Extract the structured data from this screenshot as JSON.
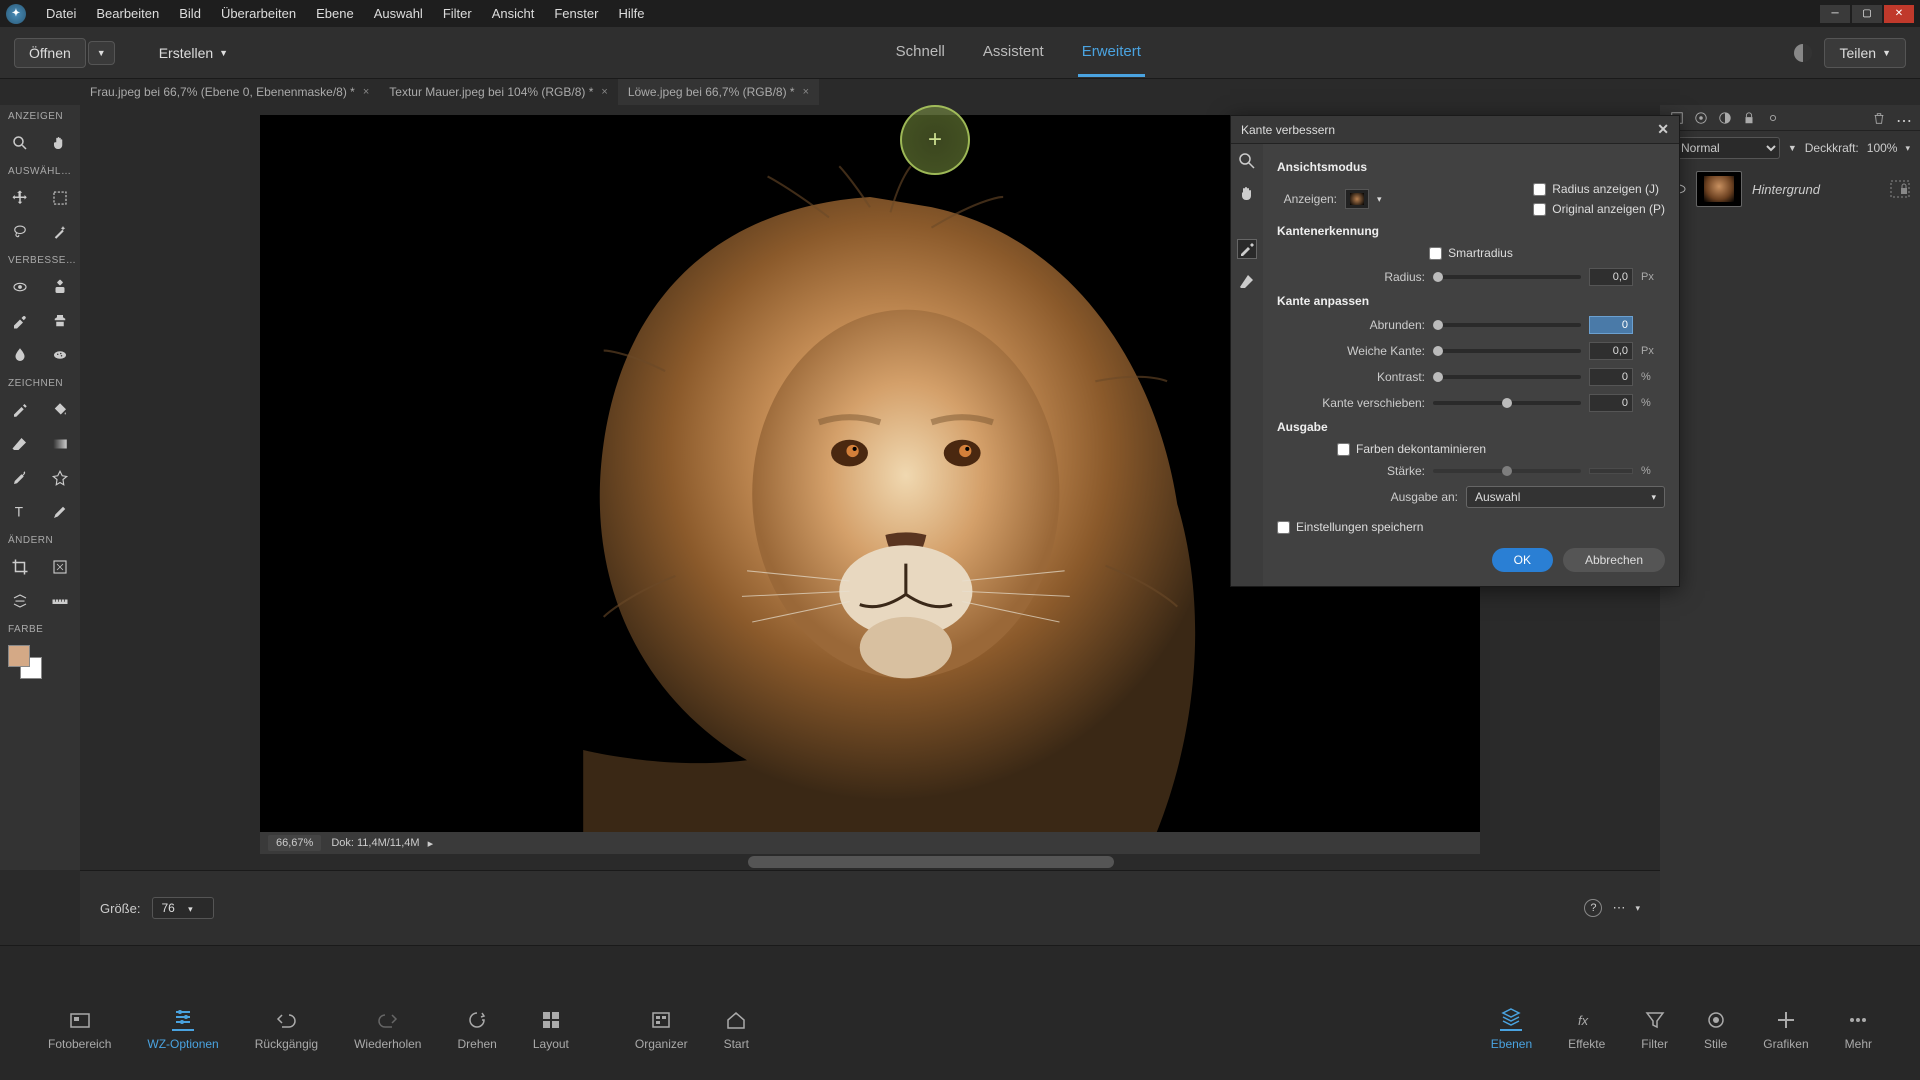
{
  "menubar": {
    "items": [
      "Datei",
      "Bearbeiten",
      "Bild",
      "Überarbeiten",
      "Ebene",
      "Auswahl",
      "Filter",
      "Ansicht",
      "Fenster",
      "Hilfe"
    ]
  },
  "toolbar": {
    "open_label": "Öffnen",
    "create_label": "Erstellen",
    "modes": [
      "Schnell",
      "Assistent",
      "Erweitert"
    ],
    "active_mode": 2,
    "share_label": "Teilen"
  },
  "doc_tabs": [
    {
      "label": "Frau.jpeg bei 66,7% (Ebene 0, Ebenenmaske/8) *"
    },
    {
      "label": "Textur Mauer.jpeg bei 104% (RGB/8) *"
    },
    {
      "label": "Löwe.jpeg bei 66,7% (RGB/8) *"
    }
  ],
  "active_doc": 2,
  "left_panel": {
    "sections": {
      "anzeigen": "ANZEIGEN",
      "auswaehlen": "AUSWÄHL…",
      "verbessern": "VERBESSE…",
      "zeichnen": "ZEICHNEN",
      "aendern": "ÄNDERN",
      "farbe": "FARBE"
    },
    "fg_color": "#d4a986",
    "bg_color": "#ffffff"
  },
  "canvas": {
    "zoom": "66,67%",
    "doc_info": "Dok: 11,4M/11,4M"
  },
  "right_panel": {
    "trash_icon": "trash",
    "blend_mode": "Normal",
    "opacity_label": "Deckkraft:",
    "opacity_value": "100%",
    "layer_name": "Hintergrund"
  },
  "dialog": {
    "title": "Kante verbessern",
    "section_view": "Ansichtsmodus",
    "view_label": "Anzeigen:",
    "show_radius": "Radius anzeigen (J)",
    "show_original": "Original anzeigen (P)",
    "section_edge": "Kantenerkennung",
    "smart_radius": "Smartradius",
    "radius_label": "Radius:",
    "radius_value": "0,0",
    "radius_unit": "Px",
    "section_adjust": "Kante anpassen",
    "smooth_label": "Abrunden:",
    "smooth_value": "0",
    "feather_label": "Weiche Kante:",
    "feather_value": "0,0",
    "feather_unit": "Px",
    "contrast_label": "Kontrast:",
    "contrast_value": "0",
    "contrast_unit": "%",
    "shift_label": "Kante verschieben:",
    "shift_value": "0",
    "shift_unit": "%",
    "section_output": "Ausgabe",
    "decontaminate": "Farben dekontaminieren",
    "amount_label": "Stärke:",
    "amount_unit": "%",
    "output_to_label": "Ausgabe an:",
    "output_to_value": "Auswahl",
    "remember": "Einstellungen speichern",
    "ok": "OK",
    "cancel": "Abbrechen"
  },
  "tool_options": {
    "size_label": "Größe:",
    "size_value": "76"
  },
  "bottom_bar": {
    "left_items": [
      "Fotobereich",
      "WZ-Optionen",
      "Rückgängig",
      "Wiederholen",
      "Drehen",
      "Layout",
      "Organizer",
      "Start"
    ],
    "left_active": 1,
    "right_items": [
      "Ebenen",
      "Effekte",
      "Filter",
      "Stile",
      "Grafiken",
      "Mehr"
    ],
    "right_active": 0
  }
}
